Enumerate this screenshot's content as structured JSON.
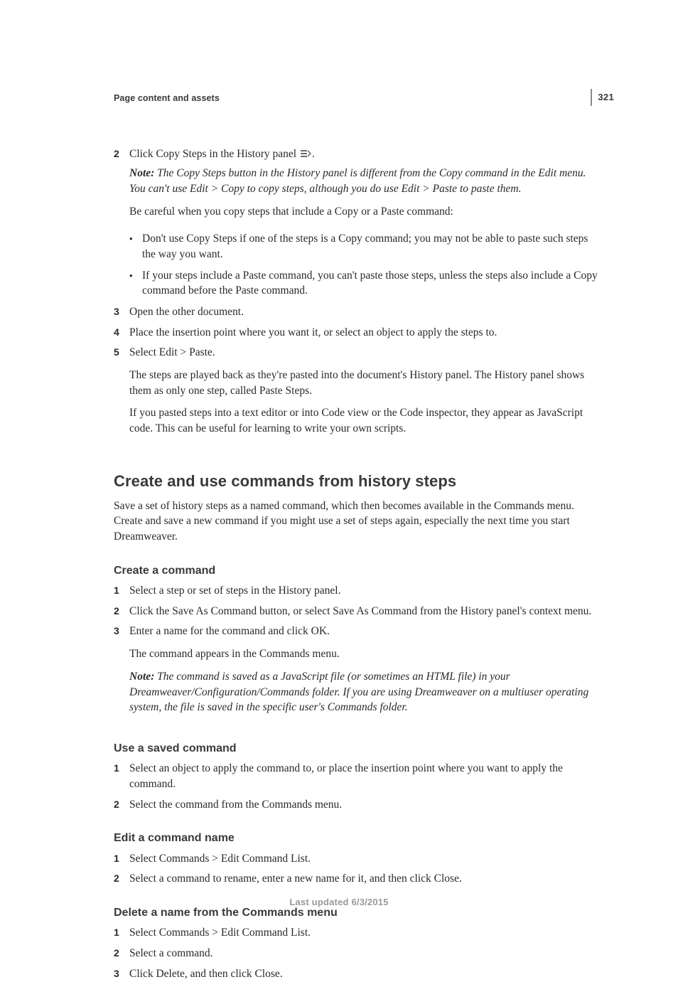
{
  "page": {
    "number": "321",
    "section_header": "Page content and assets",
    "footer": "Last updated 6/3/2015"
  },
  "block1": {
    "s2": {
      "num": "2",
      "text_a": "Click Copy Steps in the History panel ",
      "text_b": "."
    },
    "note1": {
      "label": "Note: ",
      "body": "The Copy Steps button in the History panel is different from the Copy command in the Edit menu. You can't use Edit > Copy to copy steps, although you do use Edit > Paste to paste them."
    },
    "p1": "Be careful when you copy steps that include a Copy or a Paste command:",
    "b1": "Don't use Copy Steps if one of the steps is a Copy command; you may not be able to paste such steps the way you want.",
    "b2": "If your steps include a Paste command, you can't paste those steps, unless the steps also include a Copy command before the Paste command.",
    "s3": {
      "num": "3",
      "text": "Open the other document."
    },
    "s4": {
      "num": "4",
      "text": "Place the insertion point where you want it, or select an object to apply the steps to."
    },
    "s5": {
      "num": "5",
      "text": "Select Edit > Paste."
    },
    "p2": "The steps are played back as they're pasted into the document's History panel. The History panel shows them as only one step, called Paste Steps.",
    "p3": "If you pasted steps into a text editor or into Code view or the Code inspector, they appear as JavaScript code. This can be useful for learning to write your own scripts."
  },
  "sec2": {
    "h2": "Create and use commands from history steps",
    "intro": "Save a set of history steps as a named command, which then becomes available in the Commands menu. Create and save a new command if you might use a set of steps again, especially the next time you start Dreamweaver.",
    "h3a": "Create a command",
    "a1": {
      "num": "1",
      "text": "Select a step or set of steps in the History panel."
    },
    "a2": {
      "num": "2",
      "text": "Click the Save As Command button, or select Save As Command from the History panel's context menu."
    },
    "a3": {
      "num": "3",
      "text": "Enter a name for the command and click OK."
    },
    "a_p1": "The command appears in the Commands menu.",
    "a_note": {
      "label": "Note: ",
      "body": "The command is saved as a JavaScript file (or sometimes an HTML file) in your Dreamweaver/Configuration/Commands folder. If you are using Dreamweaver on a multiuser operating system, the file is saved in the specific user's Commands folder."
    },
    "h3b": "Use a saved command",
    "b1": {
      "num": "1",
      "text": "Select an object to apply the command to, or place the insertion point where you want to apply the command."
    },
    "b2": {
      "num": "2",
      "text": "Select the command from the Commands menu."
    },
    "h3c": "Edit a command name",
    "c1": {
      "num": "1",
      "text": "Select Commands > Edit Command List."
    },
    "c2": {
      "num": "2",
      "text": "Select a command to rename, enter a new name for it, and then click Close."
    },
    "h3d": "Delete a name from the Commands menu",
    "d1": {
      "num": "1",
      "text": "Select Commands > Edit Command List."
    },
    "d2": {
      "num": "2",
      "text": "Select a command."
    },
    "d3": {
      "num": "3",
      "text": "Click Delete, and then click Close."
    }
  }
}
